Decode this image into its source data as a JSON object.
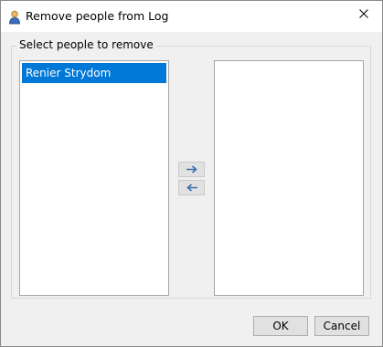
{
  "window": {
    "title": "Remove people from Log",
    "title_icon": "person-icon",
    "close_icon": "close-icon"
  },
  "group": {
    "legend": "Select people to remove"
  },
  "available_list": {
    "items": [
      {
        "label": "Renier Strydom",
        "selected": true
      }
    ]
  },
  "selected_list": {
    "items": []
  },
  "transfer": {
    "add_icon": "arrow-right-icon",
    "remove_icon": "arrow-left-icon"
  },
  "buttons": {
    "ok_label": "OK",
    "cancel_label": "Cancel"
  },
  "colors": {
    "selection": "#0078d7",
    "arrow": "#3a6fb0",
    "dialog_bg": "#f0f0f0"
  }
}
